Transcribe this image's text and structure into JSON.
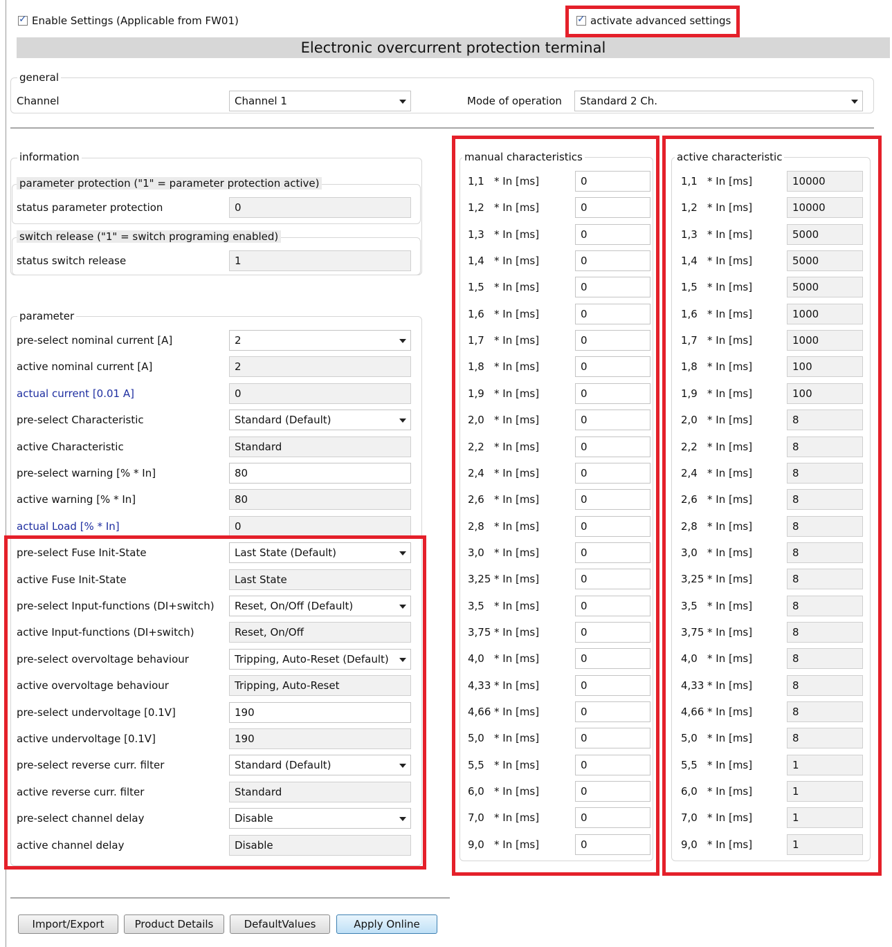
{
  "enable_settings": {
    "label": "Enable Settings (Applicable from FW01)",
    "checked": true
  },
  "advanced_settings": {
    "label": "activate advanced settings",
    "checked": true
  },
  "title": "Electronic overcurrent protection terminal",
  "general": {
    "legend": "general",
    "channel_label": "Channel",
    "channel_value": "Channel 1",
    "mode_label": "Mode of operation",
    "mode_value": "Standard 2 Ch."
  },
  "information": {
    "legend": "information",
    "param_protection_legend": "parameter protection (\"1\" = parameter protection active)",
    "status_param_protection_label": "status parameter protection",
    "status_param_protection_value": "0",
    "switch_release_legend": "switch release (\"1\" = switch programing enabled)",
    "status_switch_release_label": "status switch release",
    "status_switch_release_value": "1"
  },
  "parameter": {
    "legend": "parameter",
    "rows": [
      {
        "label": "pre-select nominal current [A]",
        "value": "2",
        "kind": "dd"
      },
      {
        "label": "active nominal current [A]",
        "value": "2",
        "kind": "ro"
      },
      {
        "label": "actual current [0.01 A]",
        "value": "0",
        "kind": "ro",
        "blue": true
      },
      {
        "label": "pre-select Characteristic",
        "value": "Standard (Default)",
        "kind": "dd"
      },
      {
        "label": "active Characteristic",
        "value": "Standard",
        "kind": "ro"
      },
      {
        "label": "pre-select warning [% * In]",
        "value": "80",
        "kind": "edit"
      },
      {
        "label": "active warning [% * In]",
        "value": "80",
        "kind": "ro"
      },
      {
        "label": "actual Load [% * In]",
        "value": "0",
        "kind": "ro",
        "blue": true
      },
      {
        "label": "pre-select Fuse Init-State",
        "value": "Last State (Default)",
        "kind": "dd"
      },
      {
        "label": "active Fuse Init-State",
        "value": "Last State",
        "kind": "ro"
      },
      {
        "label": "pre-select Input-functions (DI+switch)",
        "value": "Reset, On/Off (Default)",
        "kind": "dd"
      },
      {
        "label": "active Input-functions (DI+switch)",
        "value": "Reset, On/Off",
        "kind": "ro"
      },
      {
        "label": "pre-select overvoltage behaviour",
        "value": "Tripping, Auto-Reset (Default)",
        "kind": "dd"
      },
      {
        "label": "active overvoltage behaviour",
        "value": "Tripping, Auto-Reset",
        "kind": "ro"
      },
      {
        "label": "pre-select undervoltage [0.1V]",
        "value": "190",
        "kind": "edit"
      },
      {
        "label": "active undervoltage [0.1V]",
        "value": "190",
        "kind": "ro"
      },
      {
        "label": "pre-select reverse curr. filter",
        "value": "Standard (Default)",
        "kind": "dd"
      },
      {
        "label": "active reverse curr. filter",
        "value": "Standard",
        "kind": "ro"
      },
      {
        "label": "pre-select channel delay",
        "value": "Disable",
        "kind": "dd"
      },
      {
        "label": "active channel delay",
        "value": "Disable",
        "kind": "ro"
      }
    ]
  },
  "manual_characteristics": {
    "legend": "manual characteristics",
    "factors": [
      "1,1",
      "1,2",
      "1,3",
      "1,4",
      "1,5",
      "1,6",
      "1,7",
      "1,8",
      "1,9",
      "2,0",
      "2,2",
      "2,4",
      "2,6",
      "2,8",
      "3,0",
      "3,25",
      "3,5",
      "3,75",
      "4,0",
      "4,33",
      "4,66",
      "5,0",
      "5,5",
      "6,0",
      "7,0",
      "9,0"
    ],
    "unit": "* In [ms]",
    "values": [
      "0",
      "0",
      "0",
      "0",
      "0",
      "0",
      "0",
      "0",
      "0",
      "0",
      "0",
      "0",
      "0",
      "0",
      "0",
      "0",
      "0",
      "0",
      "0",
      "0",
      "0",
      "0",
      "0",
      "0",
      "0",
      "0"
    ]
  },
  "active_characteristic": {
    "legend": "active characteristic",
    "factors": [
      "1,1",
      "1,2",
      "1,3",
      "1,4",
      "1,5",
      "1,6",
      "1,7",
      "1,8",
      "1,9",
      "2,0",
      "2,2",
      "2,4",
      "2,6",
      "2,8",
      "3,0",
      "3,25",
      "3,5",
      "3,75",
      "4,0",
      "4,33",
      "4,66",
      "5,0",
      "5,5",
      "6,0",
      "7,0",
      "9,0"
    ],
    "unit": "* In [ms]",
    "values": [
      "10000",
      "10000",
      "5000",
      "5000",
      "5000",
      "1000",
      "1000",
      "100",
      "100",
      "8",
      "8",
      "8",
      "8",
      "8",
      "8",
      "8",
      "8",
      "8",
      "8",
      "8",
      "8",
      "8",
      "1",
      "1",
      "1",
      "1"
    ]
  },
  "buttons": {
    "import_export": "Import/Export",
    "product_details": "Product Details",
    "default_values": "DefaultValues",
    "apply_online": "Apply Online"
  },
  "colors": {
    "highlight": "#e4202a",
    "link_blue": "#1e2ea0",
    "title_bg": "#d7d7d7"
  }
}
